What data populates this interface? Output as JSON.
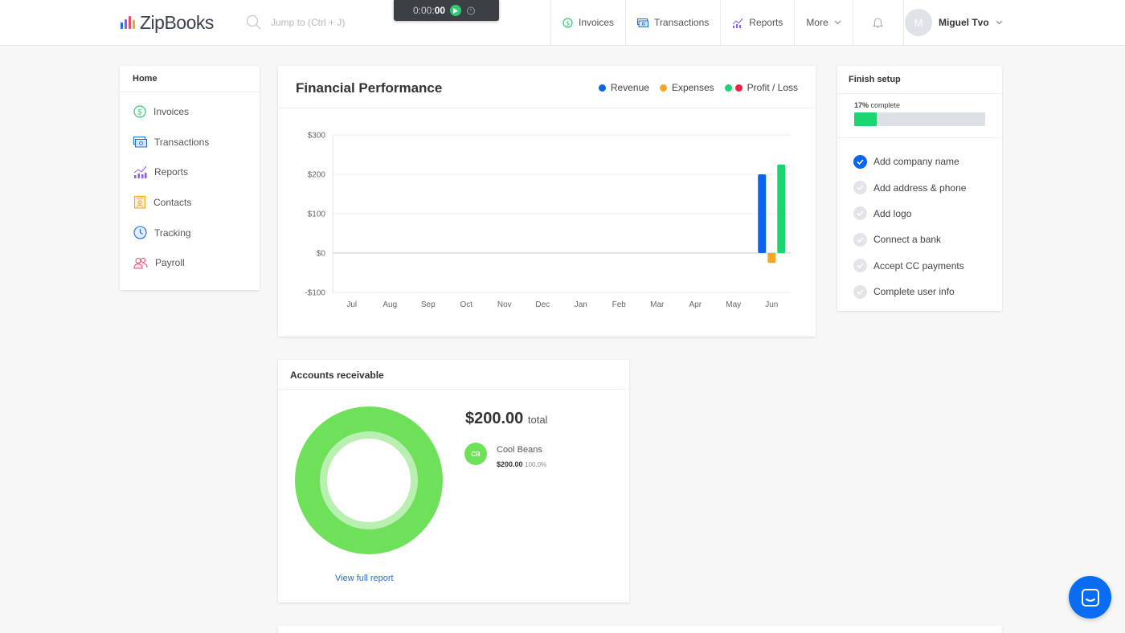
{
  "app": {
    "name": "ZipBooks"
  },
  "search": {
    "placeholder": "Jump to (Ctrl + J)"
  },
  "timer": {
    "prefix": "0:00:",
    "seconds": "00"
  },
  "nav": {
    "items": [
      {
        "label": "Invoices",
        "icon": "dollar-icon"
      },
      {
        "label": "Transactions",
        "icon": "cash-icon"
      },
      {
        "label": "Reports",
        "icon": "chart-icon"
      },
      {
        "label": "More",
        "icon": "chevron-down-icon"
      }
    ]
  },
  "user": {
    "initial": "M",
    "name": "Miguel Tvo"
  },
  "home": {
    "title": "Home",
    "items": [
      {
        "label": "Invoices",
        "icon": "dollar-icon",
        "color": "#2ecc71"
      },
      {
        "label": "Transactions",
        "icon": "cash-icon",
        "color": "#1a6fe8"
      },
      {
        "label": "Reports",
        "icon": "chart-icon",
        "color": "#8b5cf6"
      },
      {
        "label": "Contacts",
        "icon": "contact-card-icon",
        "color": "#f5a623"
      },
      {
        "label": "Tracking",
        "icon": "clock-icon",
        "color": "#1a6fe8"
      },
      {
        "label": "Payroll",
        "icon": "people-icon",
        "color": "#ef4b6c"
      }
    ]
  },
  "financial": {
    "title": "Financial Performance",
    "legend": {
      "revenue": "Revenue",
      "expenses": "Expenses",
      "profit": "Profit / Loss"
    }
  },
  "chart_data": {
    "type": "bar",
    "categories": [
      "Jul",
      "Aug",
      "Sep",
      "Oct",
      "Nov",
      "Dec",
      "Jan",
      "Feb",
      "Mar",
      "Apr",
      "May",
      "Jun"
    ],
    "series": [
      {
        "name": "Revenue",
        "color": "#0a64f0",
        "values": [
          0,
          0,
          0,
          0,
          0,
          0,
          0,
          0,
          0,
          0,
          0,
          200
        ]
      },
      {
        "name": "Expenses",
        "color": "#f5a623",
        "values": [
          0,
          0,
          0,
          0,
          0,
          0,
          0,
          0,
          0,
          0,
          0,
          -25
        ]
      },
      {
        "name": "Profit / Loss",
        "color": "#1bd670",
        "values": [
          0,
          0,
          0,
          0,
          0,
          0,
          0,
          0,
          0,
          0,
          0,
          225
        ]
      }
    ],
    "yticks": [
      "$300",
      "$200",
      "$100",
      "$0",
      "-$100"
    ],
    "ylim": [
      -100,
      300
    ],
    "grid": true,
    "legend_position": "top-right"
  },
  "setup": {
    "title": "Finish setup",
    "progress_value": "17%",
    "progress_suffix": "complete",
    "progress_fraction": 0.17,
    "items": [
      {
        "label": "Add company name",
        "done": true
      },
      {
        "label": "Add address & phone",
        "done": false
      },
      {
        "label": "Add logo",
        "done": false
      },
      {
        "label": "Connect a bank",
        "done": false
      },
      {
        "label": "Accept CC payments",
        "done": false
      },
      {
        "label": "Complete user info",
        "done": false
      }
    ]
  },
  "receivable": {
    "title": "Accounts receivable",
    "total": "$200.00",
    "total_label": "total",
    "customer": {
      "initials": "CB",
      "name": "Cool Beans",
      "amount": "$200.00",
      "percent": "100.0%"
    },
    "link": "View full report"
  },
  "colors": {
    "accent": "#0a64f0",
    "success": "#1bd670",
    "donut": "#6ee05a"
  }
}
